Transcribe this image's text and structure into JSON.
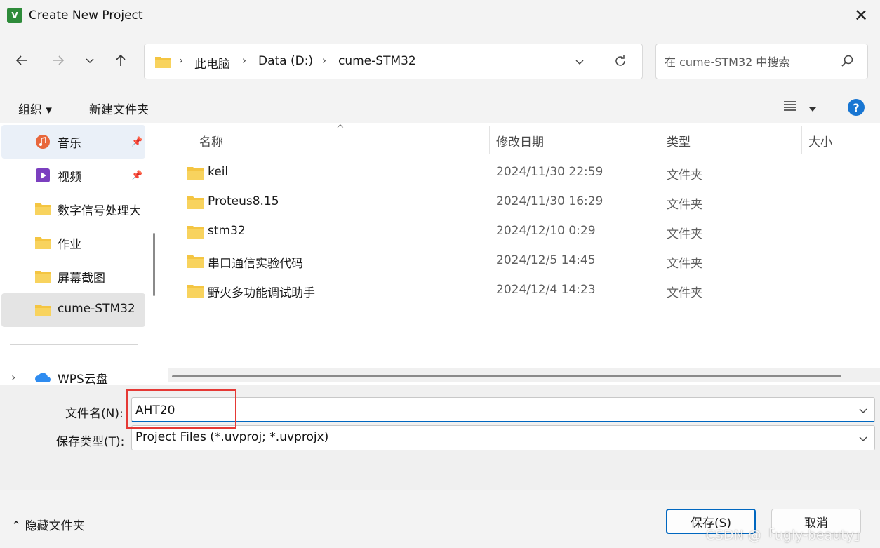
{
  "window": {
    "app_icon_text": "V",
    "title": "Create New Project"
  },
  "address": {
    "crumbs": [
      "此电脑",
      "Data (D:)",
      "cume-STM32"
    ]
  },
  "search": {
    "placeholder": "在 cume-STM32 中搜索"
  },
  "toolbar": {
    "organize": "组织 ▾",
    "new_folder": "新建文件夹",
    "help": "?"
  },
  "sidebar": {
    "items": [
      {
        "label": "音乐",
        "icon": "music-icon",
        "pinned": true
      },
      {
        "label": "视频",
        "icon": "video-icon",
        "pinned": true
      },
      {
        "label": "数字信号处理大",
        "icon": "folder-icon",
        "pinned": false
      },
      {
        "label": "作业",
        "icon": "folder-icon",
        "pinned": false
      },
      {
        "label": "屏幕截图",
        "icon": "folder-icon",
        "pinned": false
      },
      {
        "label": "cume-STM32",
        "icon": "folder-icon",
        "pinned": false
      },
      {
        "label": "WPS云盘",
        "icon": "cloud-icon",
        "pinned": false
      }
    ]
  },
  "files": {
    "columns": [
      "名称",
      "修改日期",
      "类型",
      "大小"
    ],
    "rows": [
      {
        "name": "keil",
        "date": "2024/11/30 22:59",
        "type": "文件夹"
      },
      {
        "name": "Proteus8.15",
        "date": "2024/11/30 16:29",
        "type": "文件夹"
      },
      {
        "name": "stm32",
        "date": "2024/12/10 0:29",
        "type": "文件夹"
      },
      {
        "name": "串口通信实验代码",
        "date": "2024/12/5 14:45",
        "type": "文件夹"
      },
      {
        "name": "野火多功能调试助手",
        "date": "2024/12/4 14:23",
        "type": "文件夹"
      }
    ]
  },
  "form": {
    "filename_label": "文件名(N):",
    "filename_value": "AHT20",
    "filetype_label": "保存类型(T):",
    "filetype_value": "Project Files (*.uvproj; *.uvprojx)"
  },
  "footer": {
    "hide_folders": "隐藏文件夹",
    "save": "保存(S)",
    "cancel": "取消"
  },
  "watermark": "CSDN @「ugly-beauty」",
  "colors": {
    "accent": "#0067c0",
    "folder": "#f4c542",
    "highlight_box": "#e53935"
  }
}
